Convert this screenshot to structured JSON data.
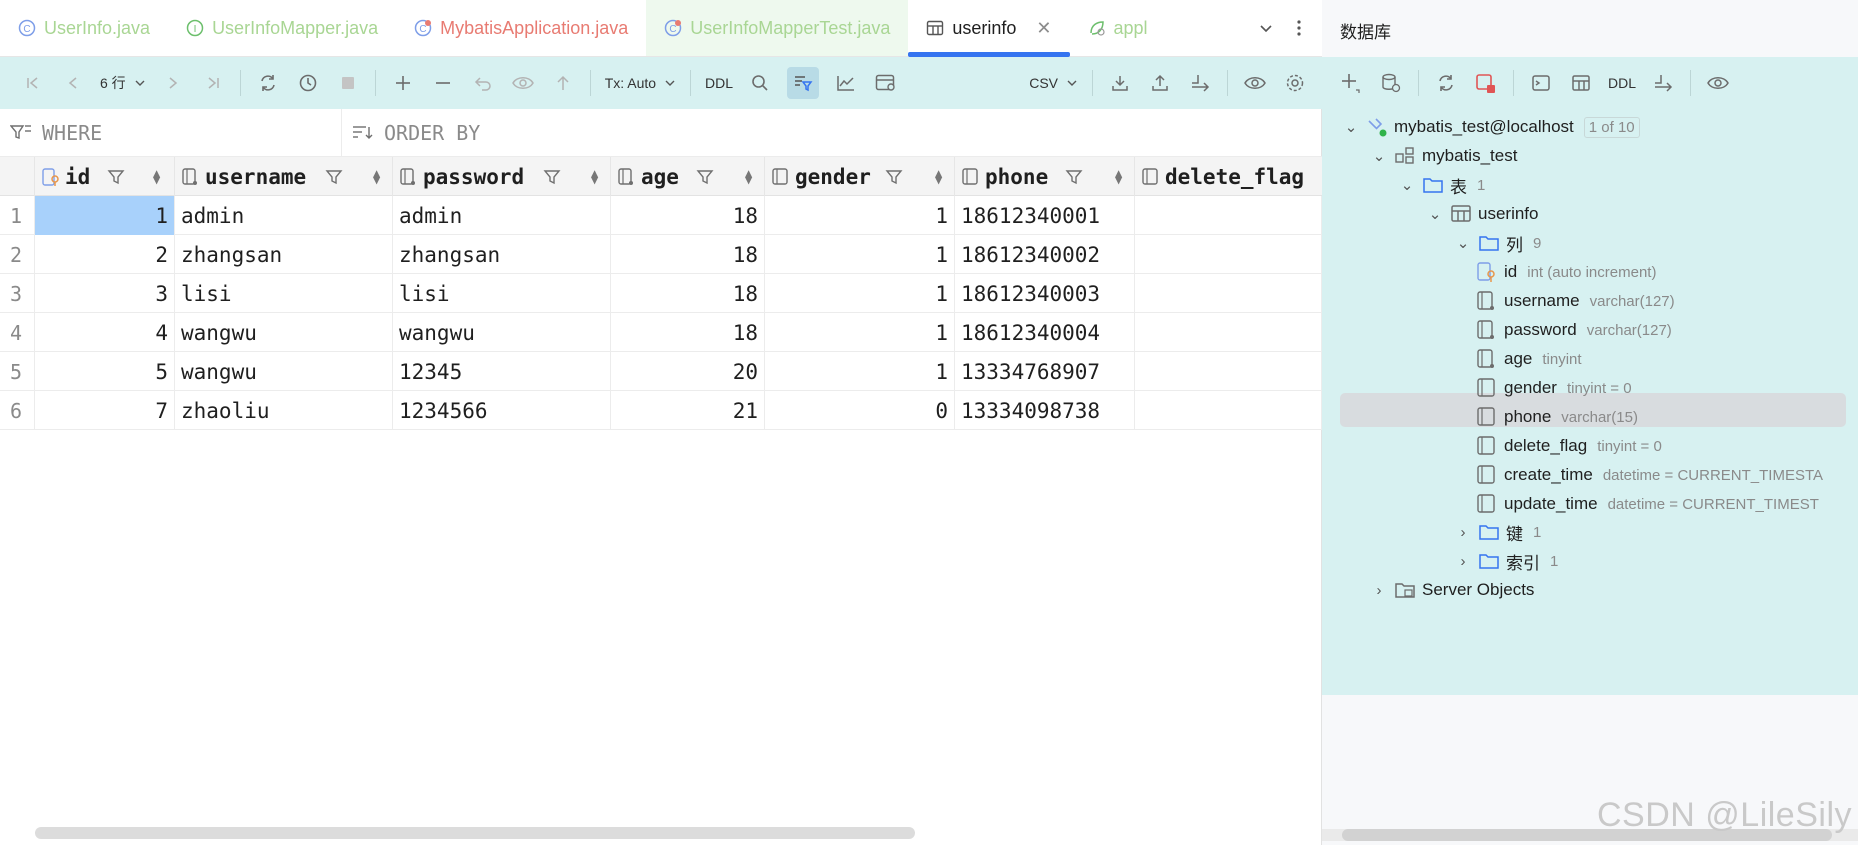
{
  "tabs": [
    {
      "label": "UserInfo.java",
      "style": "green",
      "icon": "class-icon"
    },
    {
      "label": "UserInfoMapper.java",
      "style": "green",
      "icon": "interface-icon"
    },
    {
      "label": "MybatisApplication.java",
      "style": "red",
      "icon": "spring-app-icon"
    },
    {
      "label": "UserInfoMapperTest.java",
      "style": "green",
      "icon": "test-class-icon"
    },
    {
      "label": "userinfo",
      "style": "active",
      "icon": "table-icon"
    },
    {
      "label": "appl",
      "style": "green",
      "icon": "spring-leaf-icon"
    }
  ],
  "toolbar": {
    "row_count": "6 行",
    "tx_mode": "Tx: Auto",
    "ddl_label": "DDL",
    "export_format": "CSV"
  },
  "filter": {
    "where": "WHERE",
    "order_by": "ORDER BY"
  },
  "grid": {
    "columns": [
      "id",
      "username",
      "password",
      "age",
      "gender",
      "phone",
      "delete_flag"
    ],
    "rows": [
      {
        "rn": "1",
        "id": "1",
        "username": "admin",
        "password": "admin",
        "age": "18",
        "gender": "1",
        "phone": "18612340001"
      },
      {
        "rn": "2",
        "id": "2",
        "username": "zhangsan",
        "password": "zhangsan",
        "age": "18",
        "gender": "1",
        "phone": "18612340002"
      },
      {
        "rn": "3",
        "id": "3",
        "username": "lisi",
        "password": "lisi",
        "age": "18",
        "gender": "1",
        "phone": "18612340003"
      },
      {
        "rn": "4",
        "id": "4",
        "username": "wangwu",
        "password": "wangwu",
        "age": "18",
        "gender": "1",
        "phone": "18612340004"
      },
      {
        "rn": "5",
        "id": "5",
        "username": "wangwu",
        "password": "12345",
        "age": "20",
        "gender": "1",
        "phone": "13334768907"
      },
      {
        "rn": "6",
        "id": "7",
        "username": "zhaoliu",
        "password": "1234566",
        "age": "21",
        "gender": "0",
        "phone": "13334098738"
      }
    ]
  },
  "db": {
    "title": "数据库",
    "toolbar_ddl": "DDL",
    "tree": {
      "datasource": "mybatis_test@localhost",
      "datasource_badge": "1 of 10",
      "schema": "mybatis_test",
      "tables_folder": "表",
      "tables_count": "1",
      "table": "userinfo",
      "columns_folder": "列",
      "columns_count": "9",
      "columns": [
        {
          "name": "id",
          "type": "int (auto increment)"
        },
        {
          "name": "username",
          "type": "varchar(127)"
        },
        {
          "name": "password",
          "type": "varchar(127)"
        },
        {
          "name": "age",
          "type": "tinyint"
        },
        {
          "name": "gender",
          "type": "tinyint = 0"
        },
        {
          "name": "phone",
          "type": "varchar(15)"
        },
        {
          "name": "delete_flag",
          "type": "tinyint = 0"
        },
        {
          "name": "create_time",
          "type": "datetime = CURRENT_TIMESTA"
        },
        {
          "name": "update_time",
          "type": "datetime = CURRENT_TIMEST"
        }
      ],
      "keys_folder": "键",
      "keys_count": "1",
      "indexes_folder": "索引",
      "indexes_count": "1",
      "server_objects": "Server Objects"
    }
  },
  "watermark": "CSDN @LileSily",
  "colors": {
    "accent": "#3574f0",
    "toolbar_bg": "#d7f1f1",
    "selection": "#a8d1fb"
  }
}
